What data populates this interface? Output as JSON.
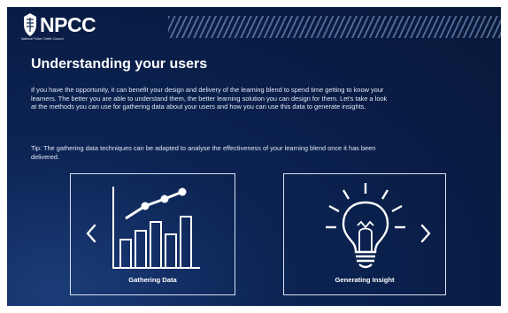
{
  "header": {
    "logo_text": "NPCC",
    "logo_subtitle": "National Police Chiefs' Council"
  },
  "page": {
    "title": "Understanding your users",
    "intro": "If you have the opportunity, it can benefit your design and delivery of the learning blend to spend time getting to know your learners. The better you are able to understand them, the better learning solution you can design for them. Let's take a look at the methods you can use for gathering data about your users and how you can use this data to generate insights.",
    "tip": "Tip: The gathering data techniques can be adapted to analyse the effectiveness of your learning blend once it has been delivered."
  },
  "cards": [
    {
      "label": "Gathering Data",
      "icon": "bar-chart-trend-icon"
    },
    {
      "label": "Generating Insight",
      "icon": "lightbulb-icon"
    }
  ],
  "nav": {
    "prev_icon": "chevron-left-icon",
    "next_icon": "chevron-right-icon"
  },
  "colors": {
    "background": "#0c2454",
    "text": "#ffffff",
    "border": "#d9e1f0"
  }
}
